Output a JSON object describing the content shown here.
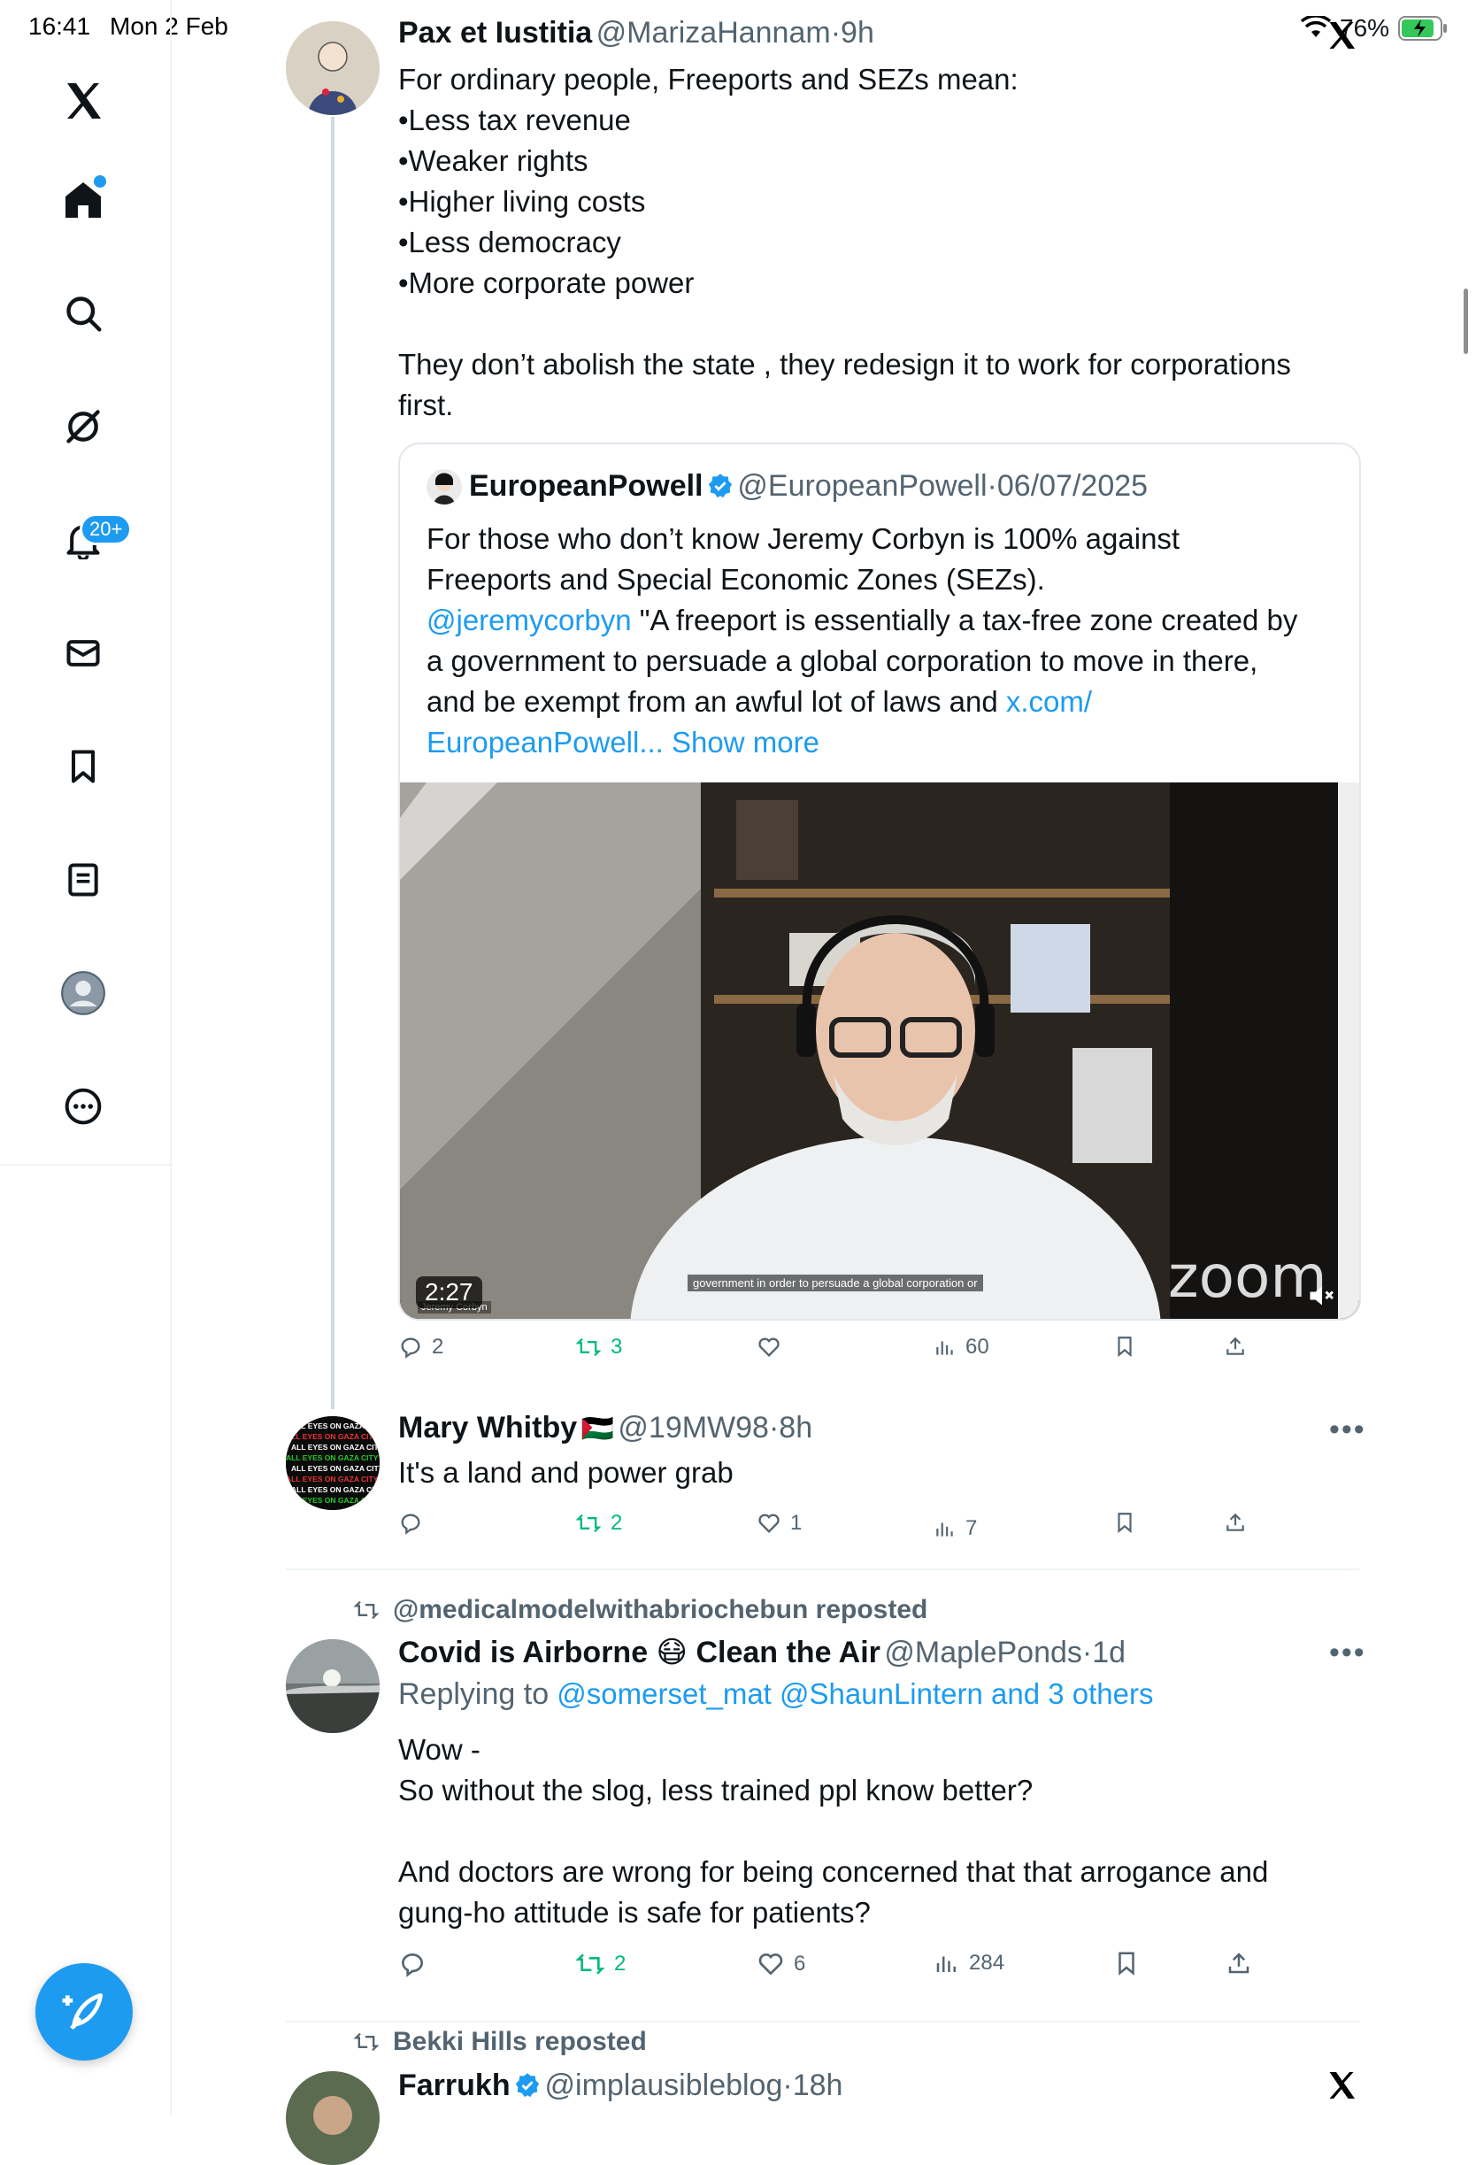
{
  "status_bar": {
    "time": "16:41",
    "date": "Mon 2 Feb",
    "battery": "76%"
  },
  "sidebar": {
    "notifications_badge": "20+",
    "accent": "#1d9bf0"
  },
  "tweets": [
    {
      "name": "Pax et Iustitia",
      "handle": "@MarizaHannam",
      "time": "9h",
      "lines": [
        "For ordinary people, Freeports and SEZs mean:",
        "•Less tax revenue",
        "•Weaker rights",
        "•Higher living costs",
        "•Less democracy",
        "•More corporate power",
        "They don’t abolish the state ,  they redesign it to work for corporations",
        "first."
      ],
      "quote": {
        "name": "EuropeanPowell",
        "handle": "@EuropeanPowell",
        "time": "06/07/2025",
        "line1": "For those who don’t know Jeremy Corbyn is 100% against",
        "line2": "Freeports and Special Economic Zones (SEZs).",
        "mention": "@jeremycorbyn",
        "line3_rest": "\"A freeport is essentially a tax-free zone created by",
        "line4": "a government to persuade a global corporation to move in there,",
        "line5": "and be exempt from an awful lot of laws and",
        "link_a": "x.com/",
        "link_b": "EuropeanPowell...",
        "show_more": "Show more",
        "video_duration": "2:27",
        "video_subtitle": "government in order to persuade a global corporation or",
        "video_brand": "zoom",
        "video_nameplate": "Jeremy Corbyn"
      },
      "stats": {
        "replies": "2",
        "reposts": "3",
        "likes": "",
        "views": "60"
      }
    },
    {
      "name": "Mary Whitby",
      "flag": "🇵🇸",
      "handle": "@19MW98",
      "time": "8h",
      "text": "It's a land and power grab",
      "avatar_text": "ALL EYES ON GAZA CITY",
      "stats": {
        "replies": "",
        "reposts": "2",
        "likes": "1",
        "views": "7"
      }
    },
    {
      "reposted_by": "@medicalmodelwithabriochebun reposted",
      "name": "Covid is Airborne 😷 Clean the Air",
      "handle": "@MaplePonds",
      "time": "1d",
      "reply_prefix": "Replying to",
      "reply_to": "@somerset_mat @ShaunLintern and 3 others",
      "lines": [
        "Wow -",
        "So without the slog, less trained ppl know better?",
        "And doctors are wrong for being concerned that that arrogance and",
        "gung-ho attitude is safe for patients?"
      ],
      "stats": {
        "replies": "",
        "reposts": "2",
        "likes": "6",
        "views": "284"
      }
    },
    {
      "reposted_by": "Bekki Hills reposted",
      "name": "Farrukh",
      "handle": "@implausibleblog",
      "time": "18h"
    }
  ],
  "dot": "·"
}
